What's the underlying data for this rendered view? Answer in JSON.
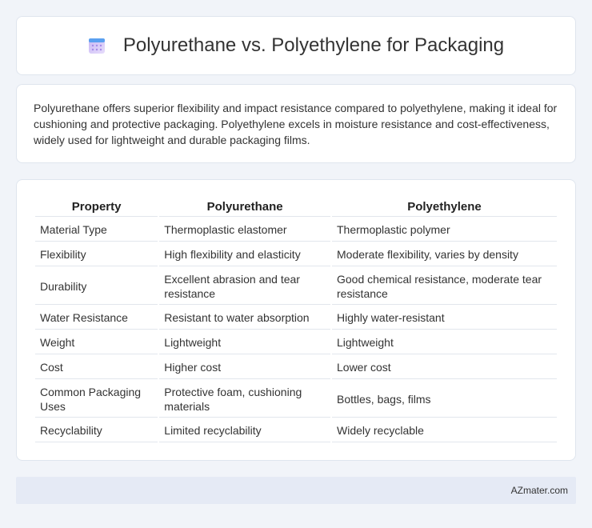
{
  "header": {
    "title": "Polyurethane vs. Polyethylene for Packaging",
    "icon": "calendar-icon"
  },
  "summary": {
    "text": "Polyurethane offers superior flexibility and impact resistance compared to polyethylene, making it ideal for cushioning and protective packaging. Polyethylene excels in moisture resistance and cost-effectiveness, widely used for lightweight and durable packaging films."
  },
  "table": {
    "headers": [
      "Property",
      "Polyurethane",
      "Polyethylene"
    ],
    "rows": [
      [
        "Material Type",
        "Thermoplastic elastomer",
        "Thermoplastic polymer"
      ],
      [
        "Flexibility",
        "High flexibility and elasticity",
        "Moderate flexibility, varies by density"
      ],
      [
        "Durability",
        "Excellent abrasion and tear resistance",
        "Good chemical resistance, moderate tear resistance"
      ],
      [
        "Water Resistance",
        "Resistant to water absorption",
        "Highly water-resistant"
      ],
      [
        "Weight",
        "Lightweight",
        "Lightweight"
      ],
      [
        "Cost",
        "Higher cost",
        "Lower cost"
      ],
      [
        "Common Packaging Uses",
        "Protective foam, cushioning materials",
        "Bottles, bags, films"
      ],
      [
        "Recyclability",
        "Limited recyclability",
        "Widely recyclable"
      ]
    ]
  },
  "footer": {
    "text": "AZmater.com"
  },
  "colors": {
    "background": "#f1f4f9",
    "card": "#ffffff",
    "footer_bg": "#e5eaf5"
  }
}
